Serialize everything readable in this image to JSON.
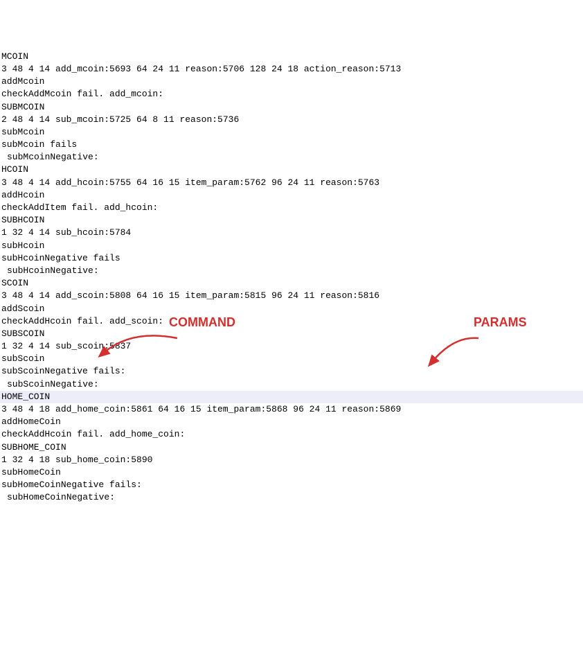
{
  "annotations": {
    "command_label": "COMMAND",
    "params_label": "PARAMS"
  },
  "lines": [
    {
      "text": "MCOIN",
      "indented": false,
      "highlighted": false
    },
    {
      "text": "3 48 4 14 add_mcoin:5693 64 24 11 reason:5706 128 24 18 action_reason:5713",
      "indented": false,
      "highlighted": false
    },
    {
      "text": "addMcoin",
      "indented": false,
      "highlighted": false
    },
    {
      "text": "checkAddMcoin fail. add_mcoin:",
      "indented": false,
      "highlighted": false
    },
    {
      "text": "SUBMCOIN",
      "indented": false,
      "highlighted": false
    },
    {
      "text": "2 48 4 14 sub_mcoin:5725 64 8 11 reason:5736",
      "indented": false,
      "highlighted": false
    },
    {
      "text": "subMcoin",
      "indented": false,
      "highlighted": false
    },
    {
      "text": "subMcoin fails",
      "indented": false,
      "highlighted": false
    },
    {
      "text": "subMcoinNegative:",
      "indented": true,
      "highlighted": false
    },
    {
      "text": "HCOIN",
      "indented": false,
      "highlighted": false
    },
    {
      "text": "3 48 4 14 add_hcoin:5755 64 16 15 item_param:5762 96 24 11 reason:5763",
      "indented": false,
      "highlighted": false
    },
    {
      "text": "addHcoin",
      "indented": false,
      "highlighted": false
    },
    {
      "text": "checkAddItem fail. add_hcoin:",
      "indented": false,
      "highlighted": false
    },
    {
      "text": "SUBHCOIN",
      "indented": false,
      "highlighted": false
    },
    {
      "text": "1 32 4 14 sub_hcoin:5784",
      "indented": false,
      "highlighted": false
    },
    {
      "text": "subHcoin",
      "indented": false,
      "highlighted": false
    },
    {
      "text": "subHcoinNegative fails",
      "indented": false,
      "highlighted": false
    },
    {
      "text": "subHcoinNegative:",
      "indented": true,
      "highlighted": false
    },
    {
      "text": "SCOIN",
      "indented": false,
      "highlighted": false
    },
    {
      "text": "3 48 4 14 add_scoin:5808 64 16 15 item_param:5815 96 24 11 reason:5816",
      "indented": false,
      "highlighted": false
    },
    {
      "text": "addScoin",
      "indented": false,
      "highlighted": false
    },
    {
      "text": "checkAddHcoin fail. add_scoin:",
      "indented": false,
      "highlighted": false
    },
    {
      "text": "SUBSCOIN",
      "indented": false,
      "highlighted": false
    },
    {
      "text": "1 32 4 14 sub_scoin:5837",
      "indented": false,
      "highlighted": false
    },
    {
      "text": "subScoin",
      "indented": false,
      "highlighted": false
    },
    {
      "text": "subScoinNegative fails:",
      "indented": false,
      "highlighted": false
    },
    {
      "text": "subScoinNegative:",
      "indented": true,
      "highlighted": false
    },
    {
      "text": "HOME_COIN",
      "indented": false,
      "highlighted": true
    },
    {
      "text": "3 48 4 18 add_home_coin:5861 64 16 15 item_param:5868 96 24 11 reason:5869",
      "indented": false,
      "highlighted": false
    },
    {
      "text": "addHomeCoin",
      "indented": false,
      "highlighted": false
    },
    {
      "text": "checkAddHcoin fail. add_home_coin:",
      "indented": false,
      "highlighted": false
    },
    {
      "text": "SUBHOME_COIN",
      "indented": false,
      "highlighted": false
    },
    {
      "text": "1 32 4 18 sub_home_coin:5890",
      "indented": false,
      "highlighted": false
    },
    {
      "text": "subHomeCoin",
      "indented": false,
      "highlighted": false
    },
    {
      "text": "subHomeCoinNegative fails:",
      "indented": false,
      "highlighted": false
    },
    {
      "text": "subHomeCoinNegative:",
      "indented": true,
      "highlighted": false
    }
  ]
}
